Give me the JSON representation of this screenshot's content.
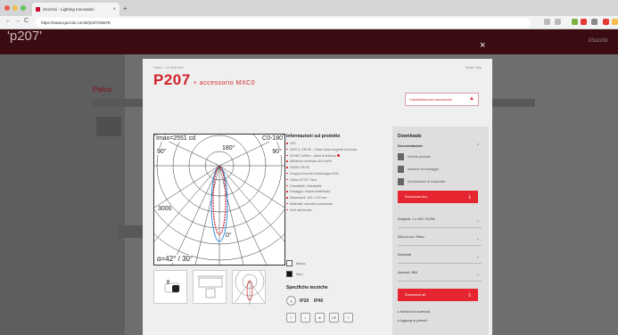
{
  "browser": {
    "tab_title": "iGuzzini - Lighting Innovation",
    "tab_close": "×",
    "new_tab": "+",
    "url": "https://www.iguzzini.com/it/p207/2667E",
    "back": "←",
    "forward": "→",
    "reload": "C",
    "dot_colors": [
      "#ee5a52",
      "#f5be4f",
      "#5fc454"
    ]
  },
  "site": {
    "page_title": "'p207'",
    "section_label": "Palco",
    "brand": "iGuzzini",
    "close": "×"
  },
  "modal": {
    "breadcrumb": "Palco · Le 400 mm",
    "share": "Share this",
    "product_code": "P207",
    "accessory": "+ accessorio MXC0",
    "configure_button": "Cambia/rimuovi accessorio",
    "diagram_labels": {
      "imax": "Imax=2551 cd",
      "plane": "C0-180",
      "a180": "180°",
      "a90_left": "90°",
      "a90_right": "90°",
      "r3000": "3000",
      "a0": "0°",
      "angle": "α=42° / 30°"
    },
    "info": {
      "title": "Informazioni sul prodotto",
      "bullets": [
        "LED",
        "3000 K, CRI 90 - Colore della sorgente luminosa",
        "30.9W/ 1405lm - valori di sistema",
        "Efficienza luminosa 45.5 lm/W",
        "3000K CRI 90",
        "Gruppo di rischio fotobiologico RG1",
        "Ottica 42°/30° Spot",
        "Orientabile: Orientabile",
        "Fissaggio: binario elettrificato",
        "Dimensioni: 100 x 210 mm",
        "Materiale: alluminio pressofuso",
        "Vedi dati tecnici"
      ],
      "swatches": [
        {
          "label": "Bianco",
          "color": "#ffffff"
        },
        {
          "label": "Nero",
          "color": "#111111"
        }
      ],
      "specs_title": "Specifiche tecniche",
      "spec_icons": [
        "IP20",
        "IP40",
        "▽",
        "◐",
        "⊕",
        "CE",
        "☉"
      ]
    },
    "downloads": {
      "title": "Downloads",
      "docs_title": "Documentazione",
      "docs": [
        "Scheda prodotto",
        "Istruzioni di montaggio",
        "Dichiarazione di conformità"
      ],
      "download_button": "Download doc",
      "selects": [
        "Sorgente: 1 x LED / 30.9W",
        "DIALux evo / Relux",
        "Eulumdat",
        "Autocad / BIM"
      ],
      "download_all": "Download all",
      "checks": [
        "Nell'area di download",
        "Aggiungi ai preferiti"
      ]
    }
  }
}
